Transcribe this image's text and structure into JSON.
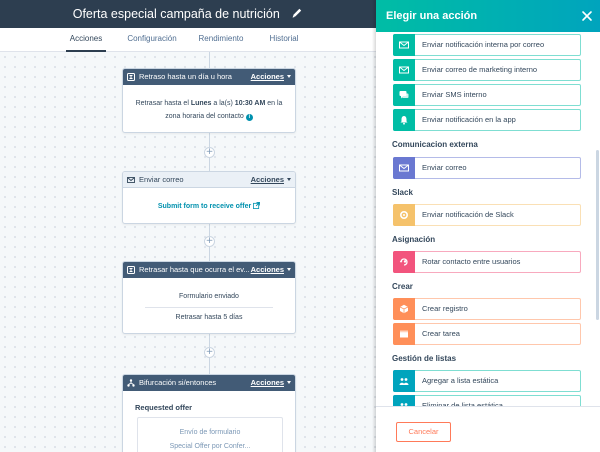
{
  "header": {
    "title": "Oferta especial campaña de nutrición",
    "edit_icon": "pencil-icon"
  },
  "tabs": [
    {
      "label": "Acciones",
      "active": true
    },
    {
      "label": "Configuración",
      "active": false
    },
    {
      "label": "Rendimiento",
      "active": false
    },
    {
      "label": "Historial",
      "active": false
    }
  ],
  "workflow": {
    "actions_label": "Acciones",
    "add_icon": "plus-icon",
    "cards": [
      {
        "title": "Retraso hasta un día u hora",
        "icon": "clock-icon",
        "text_prefix": "Retrasar hasta el ",
        "text_bold": "Lunes",
        "text_middle": " a la(s) ",
        "text_time": "10:30 AM",
        "text_suffix": " en la",
        "text_line2": "zona horaria del contacto",
        "info_icon": "info-icon"
      },
      {
        "title": "Enviar correo",
        "icon": "envelope-icon",
        "link": "Submit form to receive offer",
        "link_icon": "external-link-icon"
      },
      {
        "title": "Retrasar hasta que ocurra el ev...",
        "icon": "clock-icon",
        "line1": "Formulario enviado",
        "line2": "Retrasar hasta 5 días"
      },
      {
        "title": "Bifurcación si/entonces",
        "icon": "branch-icon",
        "branch_label": "Requested offer",
        "inner_line1": "Envío de formulario",
        "inner_line2": "Special Offer por Confer..."
      }
    ]
  },
  "panel": {
    "title": "Elegir una acción",
    "close_icon": "close-icon",
    "cancel_label": "Cancelar",
    "colors": {
      "teal": "#00bda5",
      "purple": "#6a78d1",
      "yellow": "#f5c26b",
      "pink": "#f2547d",
      "orange": "#ff8f59",
      "internal_blue": "#00a4bd"
    },
    "internal_options": [
      {
        "label": "Enviar notificación interna por correo",
        "icon": "envelope-icon"
      },
      {
        "label": "Enviar correo de marketing interno",
        "icon": "envelope-icon"
      },
      {
        "label": "Enviar SMS interno",
        "icon": "chat-icon"
      },
      {
        "label": "Enviar notificación en la app",
        "icon": "bell-icon"
      }
    ],
    "sections": [
      {
        "title": "Comunicacion externa",
        "options": [
          {
            "label": "Enviar correo",
            "icon": "envelope-icon"
          }
        ]
      },
      {
        "title": "Slack",
        "options": [
          {
            "label": "Enviar notificación de Slack",
            "icon": "slack-icon"
          }
        ]
      },
      {
        "title": "Asignación",
        "options": [
          {
            "label": "Rotar contacto entre usuarios",
            "icon": "rotate-user-icon"
          }
        ]
      },
      {
        "title": "Crear",
        "options": [
          {
            "label": "Crear registro",
            "icon": "cube-icon"
          },
          {
            "label": "Crear tarea",
            "icon": "task-icon"
          }
        ]
      },
      {
        "title": "Gestión de listas",
        "options": [
          {
            "label": "Agregar a lista estática",
            "icon": "users-icon"
          },
          {
            "label": "Eliminar de lista estática",
            "icon": "users-icon"
          }
        ]
      }
    ]
  }
}
